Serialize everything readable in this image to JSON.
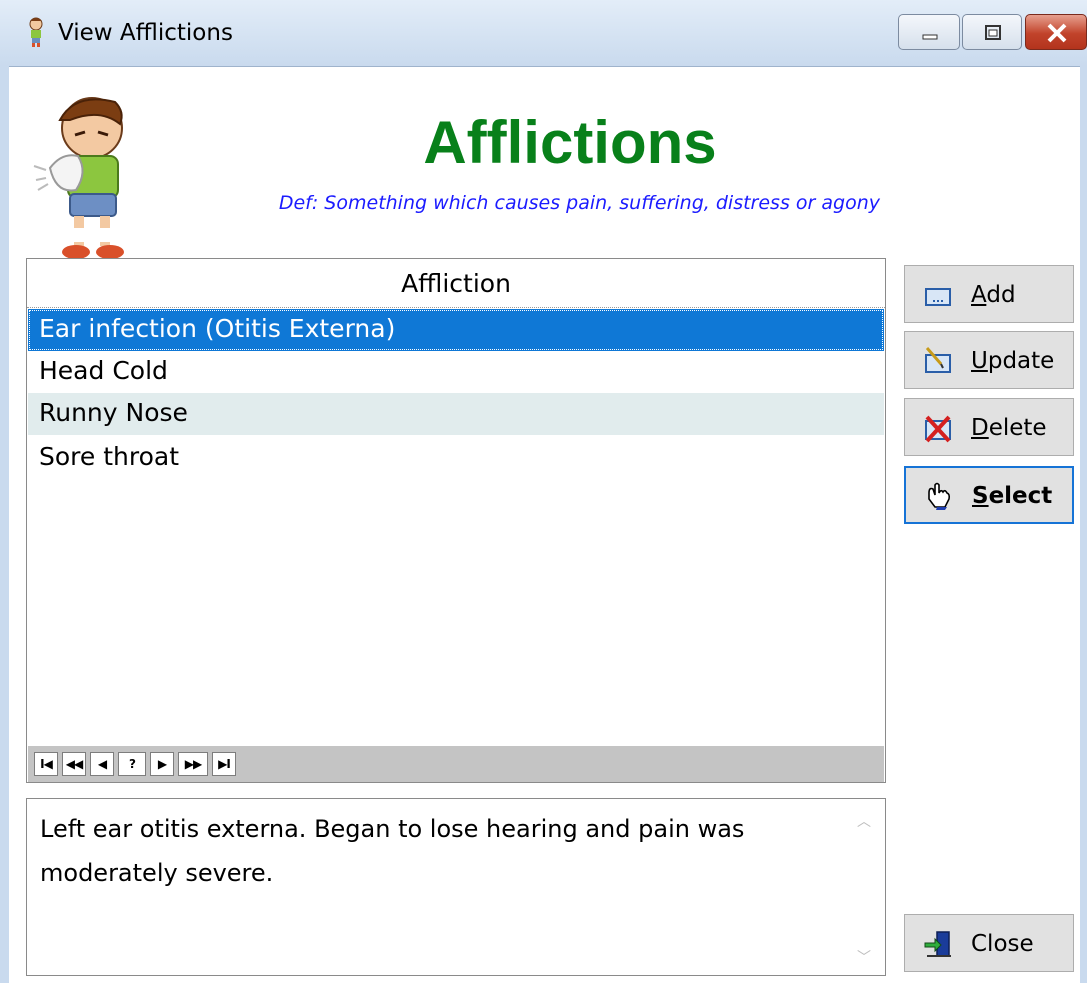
{
  "window": {
    "title": "View Afflictions",
    "icon": "sneezing-child-icon",
    "controls": [
      "minimize",
      "maximize",
      "close"
    ]
  },
  "header": {
    "heading": "Afflictions",
    "definition": "Def: Something which causes pain, suffering, distress or agony",
    "image": "sneezing-child-illustration"
  },
  "list": {
    "column_header": "Affliction",
    "rows": [
      {
        "label": "Ear infection (Otitis Externa)",
        "state": "selected"
      },
      {
        "label": "Head Cold",
        "state": "normal"
      },
      {
        "label": "Runny Nose",
        "state": "hover"
      },
      {
        "label": "Sore throat",
        "state": "normal"
      }
    ],
    "nav_buttons": [
      "I◀",
      "◀◀",
      "◀",
      "?",
      "▶",
      "▶▶",
      "▶I"
    ]
  },
  "notes": {
    "text": "Left ear otitis externa. Began to lose hearing and pain was moderately severe."
  },
  "buttons": {
    "add": {
      "label": "Add",
      "accel": "A",
      "rest": "dd",
      "icon": "add-record-icon"
    },
    "update": {
      "label": "Update",
      "accel": "U",
      "rest": "pdate",
      "icon": "edit-record-icon"
    },
    "delete": {
      "label": "Delete",
      "accel": "D",
      "rest": "elete",
      "icon": "delete-record-icon"
    },
    "select": {
      "label": "Select",
      "accel": "S",
      "rest": "elect",
      "icon": "hand-pointer-icon",
      "default": true
    },
    "close": {
      "label": "Close",
      "icon": "exit-door-icon"
    }
  },
  "colors": {
    "heading": "#08801a",
    "definition": "#1b1bff",
    "selection": "#0f78d6",
    "hover_row": "#e1eced",
    "default_button_border": "#1673d6"
  }
}
